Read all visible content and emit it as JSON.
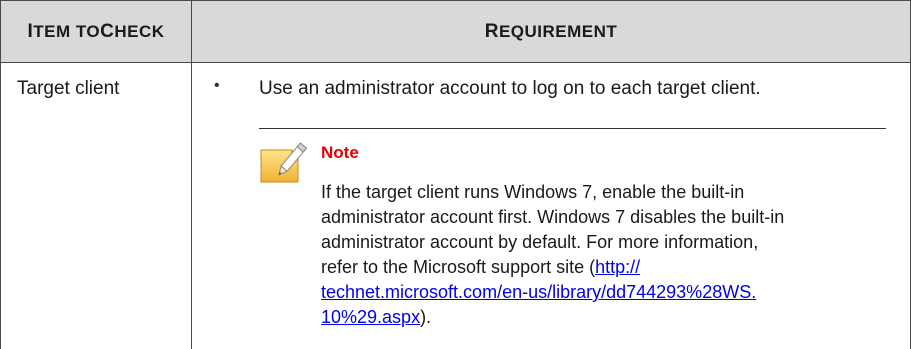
{
  "table": {
    "headers": {
      "item_first": "I",
      "item_rest": "TEM TO ",
      "item_c": "C",
      "item_end": "HECK",
      "req_first": "R",
      "req_rest": "EQUIREMENT"
    },
    "rows": [
      {
        "item": "Target client",
        "bullet": "•",
        "requirement": "Use an administrator account to log on to each target client."
      }
    ]
  },
  "note": {
    "icon": "note-pencil-icon",
    "title": "Note",
    "lines": {
      "l1": "If the target client runs Windows 7, enable the built-in",
      "l2": "administrator account first. Windows 7 disables the built-in",
      "l3": "administrator account by default. For more information,",
      "l4_text": "refer to the Microsoft support site (",
      "l4_link": "http://",
      "l5_link": "technet.microsoft.com/en-us/library/dd744293%28WS.",
      "l6_link": "10%29.aspx",
      "l6_end": ")."
    },
    "link_color": "#0000ee",
    "title_color": "#e60000"
  },
  "colors": {
    "header_bg": "#d9d9d9",
    "border": "#4a4a4a"
  }
}
